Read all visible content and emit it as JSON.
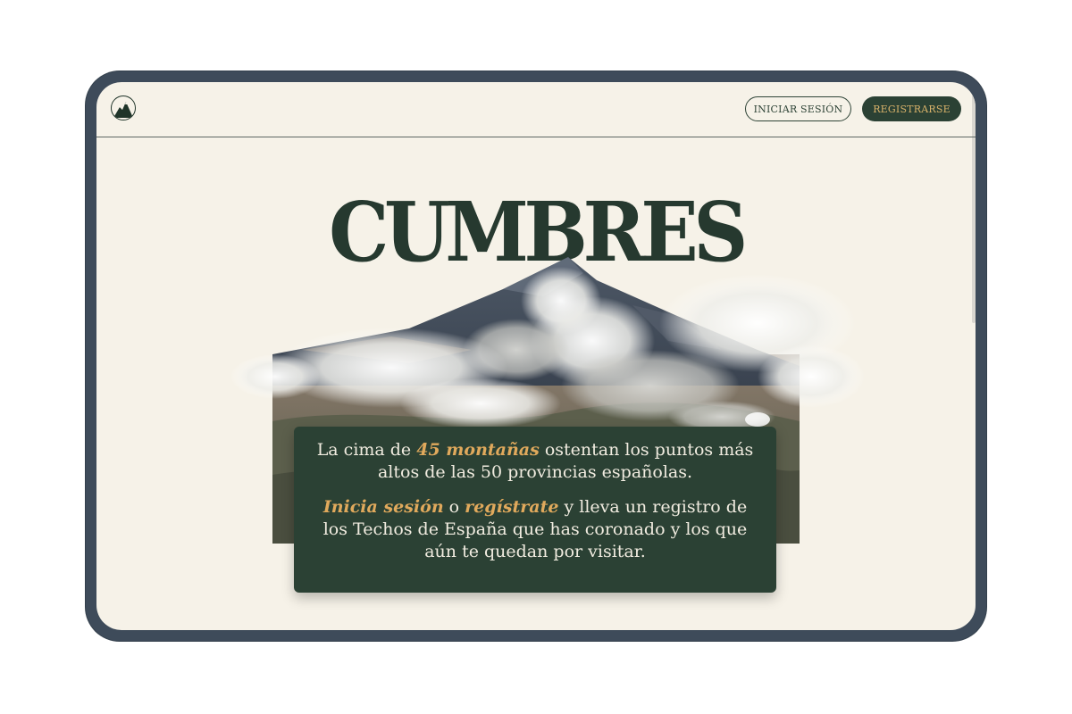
{
  "app": {
    "title": "CUMBRES"
  },
  "nav": {
    "logo_icon": "mountain-logo-icon",
    "login_label": "INICIAR SESIÓN",
    "register_label": "REGISTRARSE"
  },
  "hero": {
    "title": "CUMBRES",
    "image": "mountain-with-clouds"
  },
  "info": {
    "p1_before": "La cima de ",
    "p1_highlight": "45 montañas",
    "p1_after": " ostentan los puntos más altos de las 50 provincias españolas.",
    "p2_link_login": "Inicia sesión",
    "p2_connector": " o ",
    "p2_link_register": "regístrate",
    "p2_after": " y lleva un registro de los Techos de España que has coronado y los que aún te quedan por visitar."
  },
  "colors": {
    "background": "#f6f2e8",
    "primary_green": "#2b4134",
    "accent_gold": "#e0a95c",
    "device_frame": "#3e4b5a"
  }
}
